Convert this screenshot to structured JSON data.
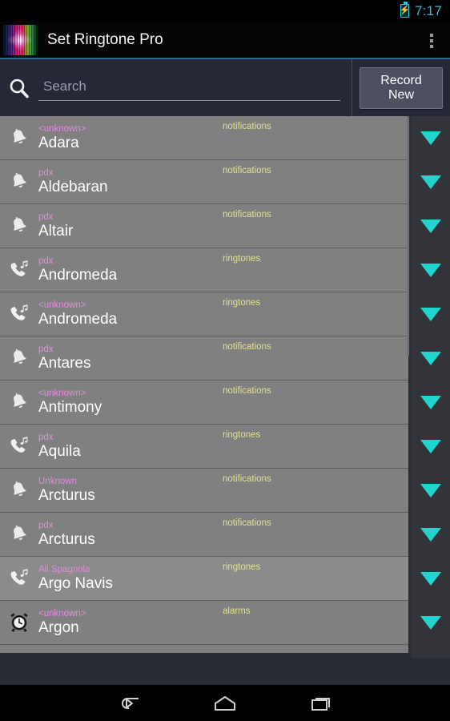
{
  "status_bar": {
    "time": "7:17",
    "battery_icon": "battery-charging-icon",
    "battery_bolt": "⚡"
  },
  "app_bar": {
    "logo_icon": "app-logo-waveform-icon",
    "title": "Set Ringtone Pro",
    "overflow_icon": "overflow-menu-icon"
  },
  "search": {
    "icon": "search-icon",
    "placeholder": "Search",
    "value": "",
    "record_button_label": "Record\nNew",
    "record_button_line1": "Record",
    "record_button_line2": "New"
  },
  "colors": {
    "accent_cyan": "#1fd6cf",
    "status_time": "#3fb9d6",
    "artist_pink": "#e28ae0",
    "type_yellow": "#e3e08a",
    "row_bg": "#808080",
    "row_bg_highlight": "#8b8b8b",
    "arrow_column_bg": "#32343a",
    "search_bar_bg": "#262838",
    "app_bar_bg": "#050505"
  },
  "list": {
    "expand_arrow_icon": "chevron-down-icon",
    "rows": [
      {
        "icon": "notification-bell-icon",
        "artist": "<unknown>",
        "title": "Adara",
        "type": "notifications",
        "highlight": false
      },
      {
        "icon": "notification-bell-icon",
        "artist": "pdx",
        "title": "Aldebaran",
        "type": "notifications",
        "highlight": false
      },
      {
        "icon": "notification-bell-icon",
        "artist": "pdx",
        "title": "Altair",
        "type": "notifications",
        "highlight": false
      },
      {
        "icon": "ringtone-phone-icon",
        "artist": "pdx",
        "title": "Andromeda",
        "type": "ringtones",
        "highlight": false
      },
      {
        "icon": "ringtone-phone-icon",
        "artist": "<unknown>",
        "title": "Andromeda",
        "type": "ringtones",
        "highlight": false
      },
      {
        "icon": "notification-bell-icon",
        "artist": "pdx",
        "title": "Antares",
        "type": "notifications",
        "highlight": false
      },
      {
        "icon": "notification-bell-icon",
        "artist": "<unknown>",
        "title": "Antimony",
        "type": "notifications",
        "highlight": false
      },
      {
        "icon": "ringtone-phone-icon",
        "artist": "pdx",
        "title": "Aquila",
        "type": "ringtones",
        "highlight": false
      },
      {
        "icon": "notification-bell-icon",
        "artist": "Unknown",
        "title": "Arcturus",
        "type": "notifications",
        "highlight": false
      },
      {
        "icon": "notification-bell-icon",
        "artist": "pdx",
        "title": "Arcturus",
        "type": "notifications",
        "highlight": false
      },
      {
        "icon": "ringtone-phone-icon",
        "artist": "Ali Spagnola",
        "title": "Argo Navis",
        "type": "ringtones",
        "highlight": true
      },
      {
        "icon": "alarm-clock-icon",
        "artist": "<unknown>",
        "title": "Argon",
        "type": "alarms",
        "highlight": false
      }
    ]
  },
  "nav_bar": {
    "back_icon": "back-icon",
    "home_icon": "home-icon",
    "recents_icon": "recents-icon"
  }
}
